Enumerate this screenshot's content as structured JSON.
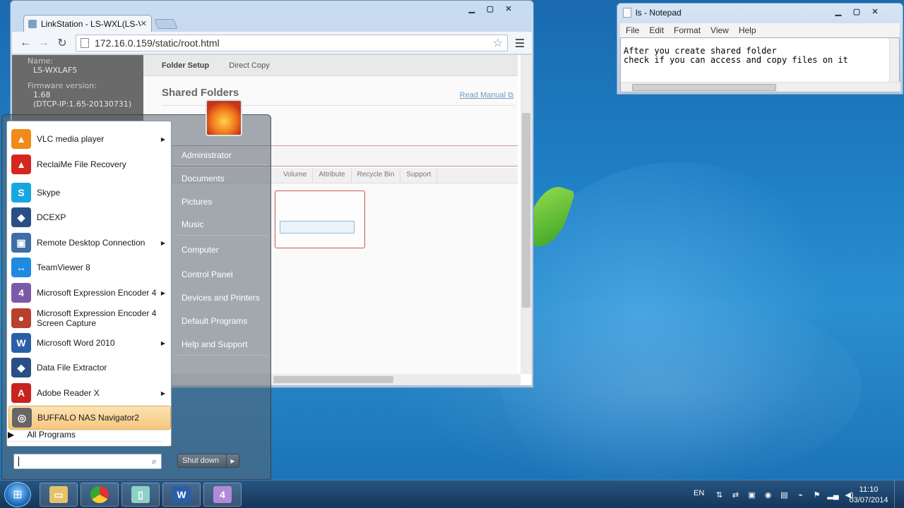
{
  "browser": {
    "tab_title": "LinkStation - LS-WXL(LS-V",
    "url": "172.16.0.159/static/root.html",
    "nas": {
      "name_label": "Name:",
      "name_value": "LS-WXLAF5",
      "fw_label": "Firmware version:",
      "fw_value": "1.68",
      "fw_detail": "(DTCP-IP:1.65-20130731)",
      "tabs": [
        "Folder Setup",
        "Direct Copy"
      ],
      "heading": "Shared Folders",
      "read_manual": "Read Manual",
      "columns": [
        "Volume",
        "Attribute",
        "Recycle Bin",
        "Support"
      ]
    }
  },
  "notepad": {
    "title": "ls - Notepad",
    "menu": [
      "File",
      "Edit",
      "Format",
      "View",
      "Help"
    ],
    "text_line1": "After you create shared folder",
    "text_line2": "check if you can access and copy files on it"
  },
  "start_menu": {
    "programs": [
      {
        "label": "VLC media player",
        "icon": "vlc-icon",
        "color": "#f08a1a",
        "glyph": "▲",
        "submenu": true
      },
      {
        "label": "ReclaiMe File Recovery",
        "icon": "reclaime-icon",
        "color": "#d6261e",
        "glyph": "▲",
        "submenu": false
      },
      {
        "label": "Skype",
        "icon": "skype-icon",
        "color": "#17a7e0",
        "glyph": "S",
        "submenu": false
      },
      {
        "label": "DCEXP",
        "icon": "dcexp-icon",
        "color": "#2a4f86",
        "glyph": "◆",
        "submenu": false
      },
      {
        "label": "Remote Desktop Connection",
        "icon": "remote-desktop-icon",
        "color": "#3d6ea8",
        "glyph": "▣",
        "submenu": true
      },
      {
        "label": "TeamViewer 8",
        "icon": "teamviewer-icon",
        "color": "#1f8ae0",
        "glyph": "↔",
        "submenu": false
      },
      {
        "label": "Microsoft Expression Encoder 4",
        "icon": "expression-encoder-icon",
        "color": "#7a5aa8",
        "glyph": "4",
        "submenu": true
      },
      {
        "label": "Microsoft Expression Encoder 4 Screen Capture",
        "icon": "screen-capture-icon",
        "color": "#b8402c",
        "glyph": "●",
        "submenu": false
      },
      {
        "label": "Microsoft Word 2010",
        "icon": "word-icon",
        "color": "#2b5ea8",
        "glyph": "W",
        "submenu": true
      },
      {
        "label": "Data File Extractor",
        "icon": "data-extractor-icon",
        "color": "#2a4f86",
        "glyph": "◆",
        "submenu": false
      },
      {
        "label": "Adobe Reader X",
        "icon": "adobe-reader-icon",
        "color": "#c8231e",
        "glyph": "A",
        "submenu": true
      },
      {
        "label": "BUFFALO NAS Navigator2",
        "icon": "nas-navigator-icon",
        "color": "#666666",
        "glyph": "◎",
        "submenu": false
      }
    ],
    "all_programs": "All Programs",
    "right_items": [
      "Administrator",
      "Documents",
      "Pictures",
      "Music",
      "Computer",
      "Control Panel",
      "Devices and Printers",
      "Default Programs",
      "Help and Support"
    ],
    "shutdown": "Shut down"
  },
  "taskbar": {
    "language": "EN",
    "time": "11:10",
    "date": "03/07/2014"
  }
}
